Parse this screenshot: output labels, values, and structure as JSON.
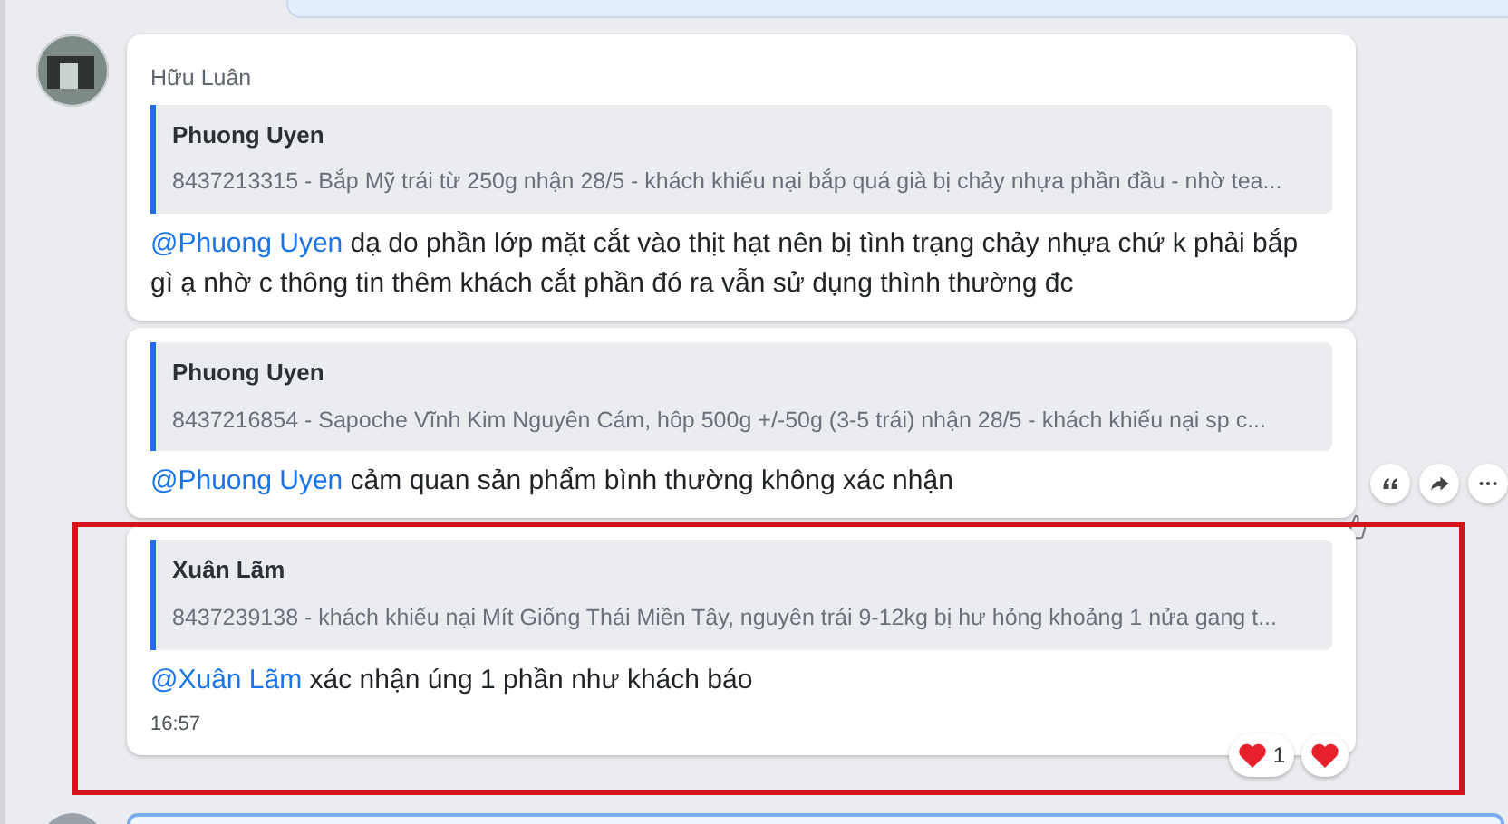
{
  "messages": [
    {
      "sender": "Hữu Luân",
      "highlighted": false,
      "quote": {
        "author": "Phuong Uyen",
        "text": "8437213315 - Bắp Mỹ trái từ 250g nhận 28/5 - khách khiếu nại bắp quá già bị chảy nhựa phần đầu - nhờ tea..."
      },
      "mention": "@Phuong Uyen",
      "text": " dạ do phần lớp mặt cắt vào thịt hạt nên bị tình trạng chảy nhựa chứ k phải bắp gì ạ nhờ c thông tin thêm khách cắt phần đó ra vẫn sử dụng thình thường đc",
      "show_actions": false
    },
    {
      "highlighted": false,
      "quote": {
        "author": "Phuong Uyen",
        "text": "8437216854 - Sapoche Vĩnh Kim Nguyên Cám, hôp 500g +/-50g (3-5 trái) nhận 28/5 - khách khiếu nại sp c..."
      },
      "mention": "@Phuong Uyen",
      "text": " cảm quan sản phẩm bình thường không xác nhận",
      "show_actions": true
    },
    {
      "highlighted": true,
      "quote": {
        "author": "Xuân Lãm",
        "text": "8437239138 - khách khiếu nại Mít Giống Thái Miền Tây, nguyên trái 9-12kg bị hư hỏng khoảng 1 nửa gang t..."
      },
      "mention": "@Xuân Lãm",
      "text": " xác nhận úng 1 phần như khách báo",
      "time": "16:57",
      "show_actions": false,
      "reactions": [
        {
          "kind": "heart",
          "count": "1"
        },
        {
          "kind": "heart"
        }
      ]
    }
  ]
}
